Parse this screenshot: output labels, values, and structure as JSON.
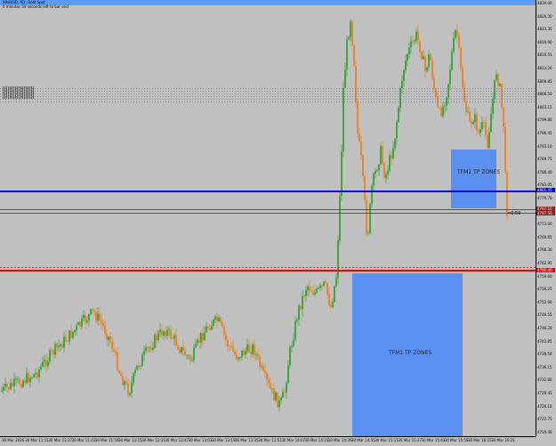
{
  "header": {
    "symbol_line": "XAUUSD, M1: Gold Spot",
    "info_line": "0 minutes 59 seconds left to bar end"
  },
  "zones": {
    "upper_label": "TFM1 TP ZONES",
    "lower_label": "TFM1 TP ZONES"
  },
  "countdown": "<0:59",
  "price_axis": {
    "labels": [
      "4830.00",
      "4826.30",
      "4823.35",
      "4819.90",
      "4816.55",
      "4813.20",
      "4809.85",
      "4806.50",
      "4803.15",
      "4799.80",
      "4796.45",
      "4793.10",
      "4789.75",
      "4786.40",
      "4783.05",
      "4779.70",
      "4776.35",
      "4773.00",
      "4769.65",
      "4766.30",
      "4762.95",
      "4759.60",
      "4756.25",
      "4752.90",
      "4749.55",
      "4746.20",
      "4742.85",
      "4739.50",
      "4736.15",
      "4732.80",
      "4729.45",
      "4726.10",
      "4722.75",
      "4719.40"
    ],
    "tags": {
      "blue_line": "4801.45",
      "current_bid": "4797.10",
      "current_ask": "4797.50",
      "red_line": "4786.40"
    }
  },
  "time_axis": {
    "labels": [
      "30 Mar 2026",
      "30 Mar 11:11",
      "30 Mar 11:27",
      "30 Mar 11:43",
      "30 Mar 11:59",
      "30 Mar 12:15",
      "30 Mar 12:31",
      "30 Mar 12:47",
      "30 Mar 13:03",
      "30 Mar 13:19",
      "30 Mar 13:35",
      "30 Mar 13:51",
      "30 Mar 14:07",
      "30 Mar 14:23",
      "30 Mar 14:39",
      "30 Mar 14:55",
      "30 Mar 15:11",
      "30 Mar 15:27",
      "30 Mar 15:43",
      "30 Mar 15:59",
      "30 Mar 16:15",
      "30 Mar 16:31"
    ]
  },
  "colors": {
    "background": "#c0c0c0",
    "bull_candle": "#22a022",
    "bear_candle": "#ee7a10",
    "zone": "#5b8ff0",
    "blue_line": "#0000ff",
    "red_line": "#ff0000",
    "title_bar": "#5b9bf0"
  }
}
